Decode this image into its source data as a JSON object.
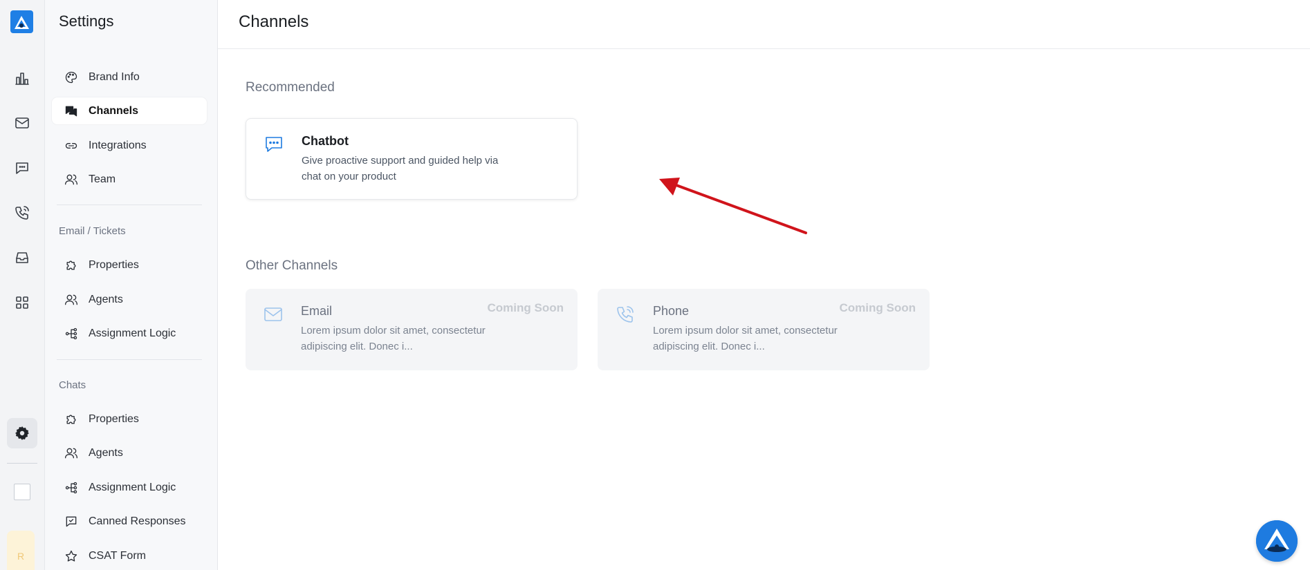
{
  "sidebar": {
    "title": "Settings",
    "general": [
      {
        "label": "Brand Info",
        "icon": "palette-icon"
      },
      {
        "label": "Channels",
        "icon": "chat-bubbles-icon",
        "active": true
      },
      {
        "label": "Integrations",
        "icon": "link-icon"
      },
      {
        "label": "Team",
        "icon": "team-icon"
      }
    ],
    "email_section": "Email / Tickets",
    "email_items": [
      {
        "label": "Properties",
        "icon": "puzzle-icon"
      },
      {
        "label": "Agents",
        "icon": "agents-icon"
      },
      {
        "label": "Assignment Logic",
        "icon": "flow-icon"
      }
    ],
    "chats_section": "Chats",
    "chats_items": [
      {
        "label": "Properties",
        "icon": "puzzle-icon"
      },
      {
        "label": "Agents",
        "icon": "agents-icon"
      },
      {
        "label": "Assignment Logic",
        "icon": "flow-icon"
      },
      {
        "label": "Canned Responses",
        "icon": "canned-response-icon"
      },
      {
        "label": "CSAT Form",
        "icon": "star-icon"
      }
    ]
  },
  "rail": {
    "avatar_initial": "R"
  },
  "main": {
    "title": "Channels",
    "recommended_title": "Recommended",
    "recommended": {
      "title": "Chatbot",
      "description": "Give proactive support and guided help via chat on your product",
      "icon": "chat-dots-icon"
    },
    "other_title": "Other Channels",
    "other": [
      {
        "title": "Email",
        "description": "Lorem ipsum dolor sit amet, consectetur adipiscing elit. Donec i...",
        "badge": "Coming Soon",
        "icon": "envelope-icon"
      },
      {
        "title": "Phone",
        "description": "Lorem ipsum dolor sit amet, consectetur adipiscing elit. Donec i...",
        "badge": "Coming Soon",
        "icon": "phone-icon"
      }
    ]
  },
  "colors": {
    "accent": "#1e7be0",
    "arrow": "#d0141b"
  }
}
